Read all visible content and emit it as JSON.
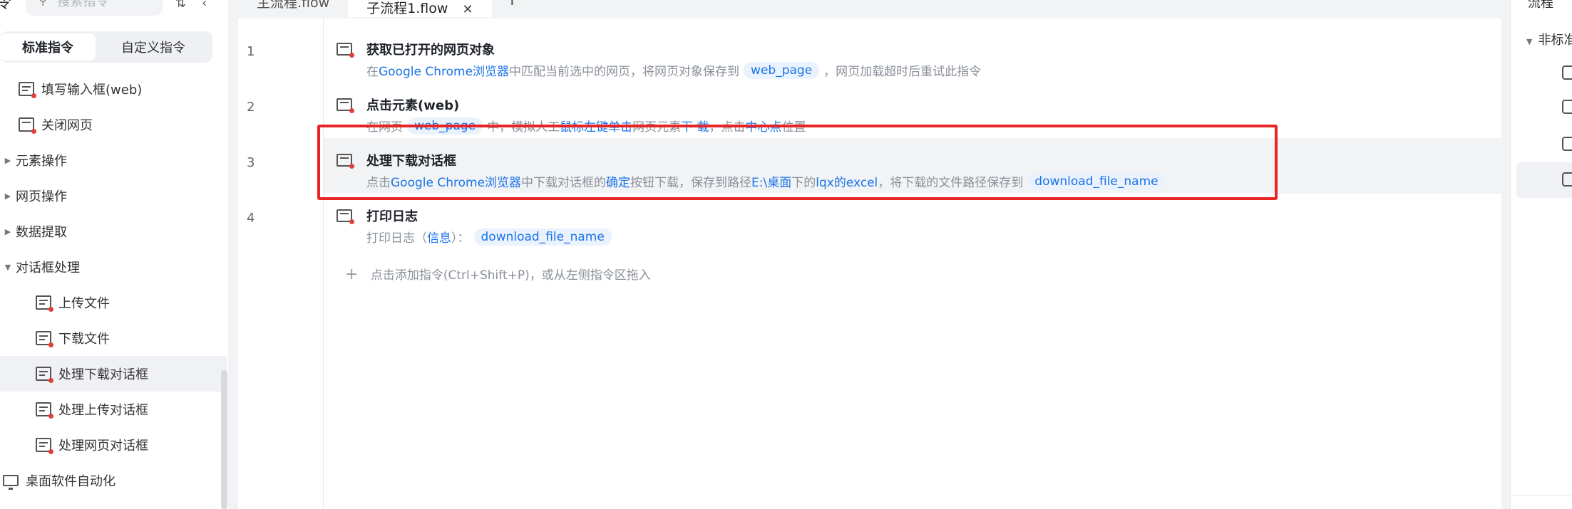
{
  "sidebar": {
    "search_placeholder": "搜索指令",
    "segment": {
      "active": "标准指令",
      "inactive": "自定义指令"
    },
    "items": [
      {
        "label": "填写输入框(web)"
      },
      {
        "label": "关闭网页"
      },
      {
        "label": "元素操作"
      },
      {
        "label": "网页操作"
      },
      {
        "label": "数据提取"
      },
      {
        "label": "对话框处理"
      },
      {
        "label": "上传文件"
      },
      {
        "label": "下载文件"
      },
      {
        "label": "处理下载对话框"
      },
      {
        "label": "处理上传对话框"
      },
      {
        "label": "处理网页对话框"
      },
      {
        "label": "桌面软件自动化"
      }
    ]
  },
  "tabs": [
    {
      "label": "主流程.flow"
    },
    {
      "label": "子流程1.flow"
    }
  ],
  "steps": [
    {
      "num": "1",
      "title": "获取已打开的网页对象",
      "desc": {
        "p1": "在",
        "k1": "Google Chrome浏览器",
        "p2": "中匹配当前选中的网页，将网页对象保存到",
        "v1": "web_page",
        "p3": "，网页加载超时后重试此指令"
      }
    },
    {
      "num": "2",
      "title": "点击元素(web)",
      "desc": {
        "p1": "在网页",
        "v1": "web_page",
        "p2": "中，模拟人工",
        "k1": "鼠标左键单击",
        "p3": "网页元素",
        "k2": "下 载",
        "p4": "，点击",
        "k3": "中心点",
        "p5": "位置"
      }
    },
    {
      "num": "3",
      "title": "处理下载对话框",
      "desc": {
        "p1": "点击",
        "k1": "Google Chrome浏览器",
        "p2": "中下载对话框的",
        "k2": "确定",
        "p3": "按钮下载，保存到路径",
        "k3": "E:\\桌面",
        "p4": "下的",
        "k4": "lqx的excel",
        "p5": "，将下载的文件路径保存到",
        "v1": "download_file_name"
      }
    },
    {
      "num": "4",
      "title": "打印日志",
      "desc": {
        "p1": "打印日志（",
        "k1": "信息",
        "p2": "）：",
        "v1": "download_file_name"
      }
    }
  ],
  "add_hint": "点击添加指令(Ctrl+Shift+P)，或从左侧指令区拖入",
  "right_panel": {
    "title": "流程",
    "node": "非标准"
  },
  "colors": {
    "accent": "#1a73e8",
    "highlight_border": "#e82424",
    "panel_bg": "#f2f3f5"
  }
}
